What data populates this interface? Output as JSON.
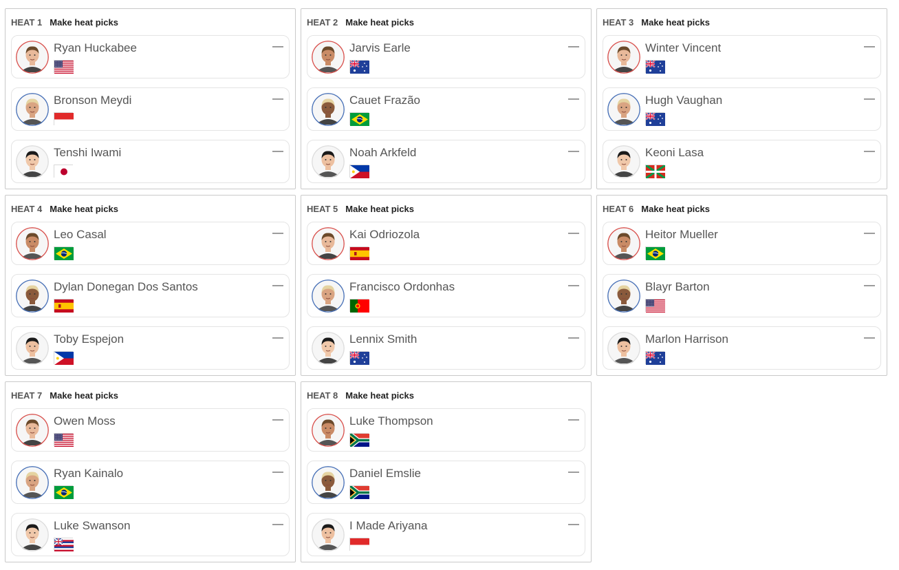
{
  "heat_label_prefix": "HEAT",
  "picks_label": "Make heat picks",
  "colors": {
    "ring_red": "#d9534f",
    "ring_blue": "#4a72b8",
    "ring_gray": "#dddddd"
  },
  "heats": [
    {
      "number": "1",
      "surfers": [
        {
          "name": "Ryan Huckabee",
          "country": "usa",
          "ring": "red",
          "score": "—"
        },
        {
          "name": "Bronson Meydi",
          "country": "indonesia",
          "ring": "blue",
          "score": "—"
        },
        {
          "name": "Tenshi Iwami",
          "country": "japan",
          "ring": "gray",
          "score": "—"
        }
      ]
    },
    {
      "number": "2",
      "surfers": [
        {
          "name": "Jarvis Earle",
          "country": "australia",
          "ring": "red",
          "score": "—"
        },
        {
          "name": "Cauet Frazão",
          "country": "brazil",
          "ring": "blue",
          "score": "—"
        },
        {
          "name": "Noah Arkfeld",
          "country": "philippines",
          "ring": "gray",
          "score": "—"
        }
      ]
    },
    {
      "number": "3",
      "surfers": [
        {
          "name": "Winter Vincent",
          "country": "australia",
          "ring": "red",
          "score": "—"
        },
        {
          "name": "Hugh Vaughan",
          "country": "australia",
          "ring": "blue",
          "score": "—"
        },
        {
          "name": "Keoni Lasa",
          "country": "basque",
          "ring": "gray",
          "score": "—"
        }
      ]
    },
    {
      "number": "4",
      "surfers": [
        {
          "name": "Leo Casal",
          "country": "brazil",
          "ring": "red",
          "score": "—"
        },
        {
          "name": "Dylan Donegan Dos Santos",
          "country": "spain",
          "ring": "blue",
          "score": "—"
        },
        {
          "name": "Toby Espejon",
          "country": "philippines",
          "ring": "gray",
          "score": "—"
        }
      ]
    },
    {
      "number": "5",
      "surfers": [
        {
          "name": "Kai Odriozola",
          "country": "spain",
          "ring": "red",
          "score": "—"
        },
        {
          "name": "Francisco Ordonhas",
          "country": "portugal",
          "ring": "blue",
          "score": "—"
        },
        {
          "name": "Lennix Smith",
          "country": "australia",
          "ring": "gray",
          "score": "—"
        }
      ]
    },
    {
      "number": "6",
      "surfers": [
        {
          "name": "Heitor Mueller",
          "country": "brazil",
          "ring": "red",
          "score": "—"
        },
        {
          "name": "Blayr Barton",
          "country": "usa",
          "ring": "blue",
          "score": "—"
        },
        {
          "name": "Marlon Harrison",
          "country": "australia",
          "ring": "gray",
          "score": "—"
        }
      ]
    },
    {
      "number": "7",
      "surfers": [
        {
          "name": "Owen Moss",
          "country": "usa",
          "ring": "red",
          "score": "—"
        },
        {
          "name": "Ryan Kainalo",
          "country": "brazil",
          "ring": "blue",
          "score": "—"
        },
        {
          "name": "Luke Swanson",
          "country": "hawaii",
          "ring": "gray",
          "score": "—"
        }
      ]
    },
    {
      "number": "8",
      "surfers": [
        {
          "name": "Luke Thompson",
          "country": "south-africa",
          "ring": "red",
          "score": "—"
        },
        {
          "name": "Daniel Emslie",
          "country": "south-africa",
          "ring": "blue",
          "score": "—"
        },
        {
          "name": "I Made Ariyana",
          "country": "indonesia",
          "ring": "gray",
          "score": "—"
        }
      ]
    }
  ]
}
